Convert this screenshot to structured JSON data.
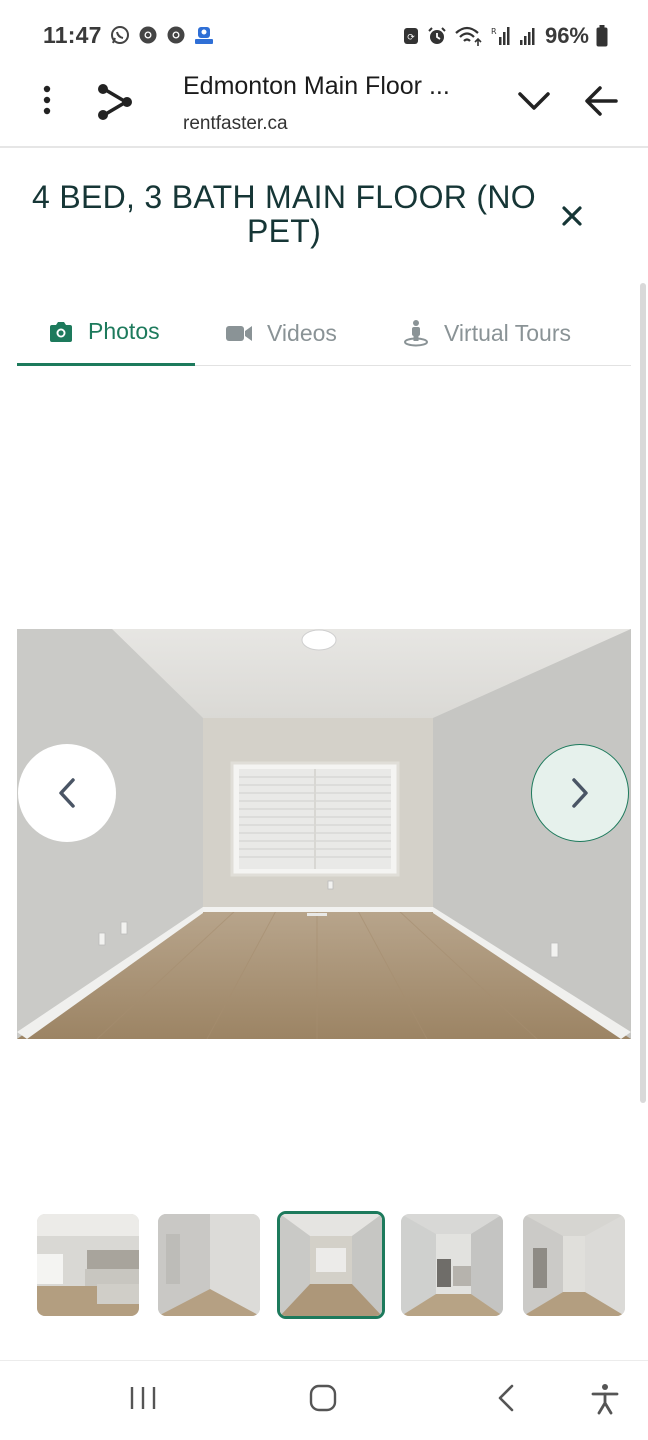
{
  "status_bar": {
    "time": "11:47",
    "battery_percent": "96%",
    "icons": [
      "whatsapp-icon",
      "chrome-icon",
      "chrome-icon",
      "app-notification-icon",
      "battery-saver-icon",
      "alarm-icon",
      "wifi-icon",
      "signal-icon",
      "signal-icon",
      "battery-icon"
    ]
  },
  "browser": {
    "title": "Edmonton Main Floor ...",
    "url": "rentfaster.ca"
  },
  "listing": {
    "title": "4 BED, 3 BATH MAIN FLOOR (NO PET)"
  },
  "tabs": [
    {
      "label": "Photos",
      "icon": "camera-icon",
      "active": true
    },
    {
      "label": "Videos",
      "icon": "video-camera-icon",
      "active": false
    },
    {
      "label": "Virtual Tours",
      "icon": "street-view-icon",
      "active": false
    }
  ],
  "gallery": {
    "thumbnail_count": 5,
    "active_thumbnail_index": 2
  },
  "colors": {
    "accent": "#1d7a5c",
    "title": "#163636",
    "inactive_tab": "#8a9396"
  }
}
